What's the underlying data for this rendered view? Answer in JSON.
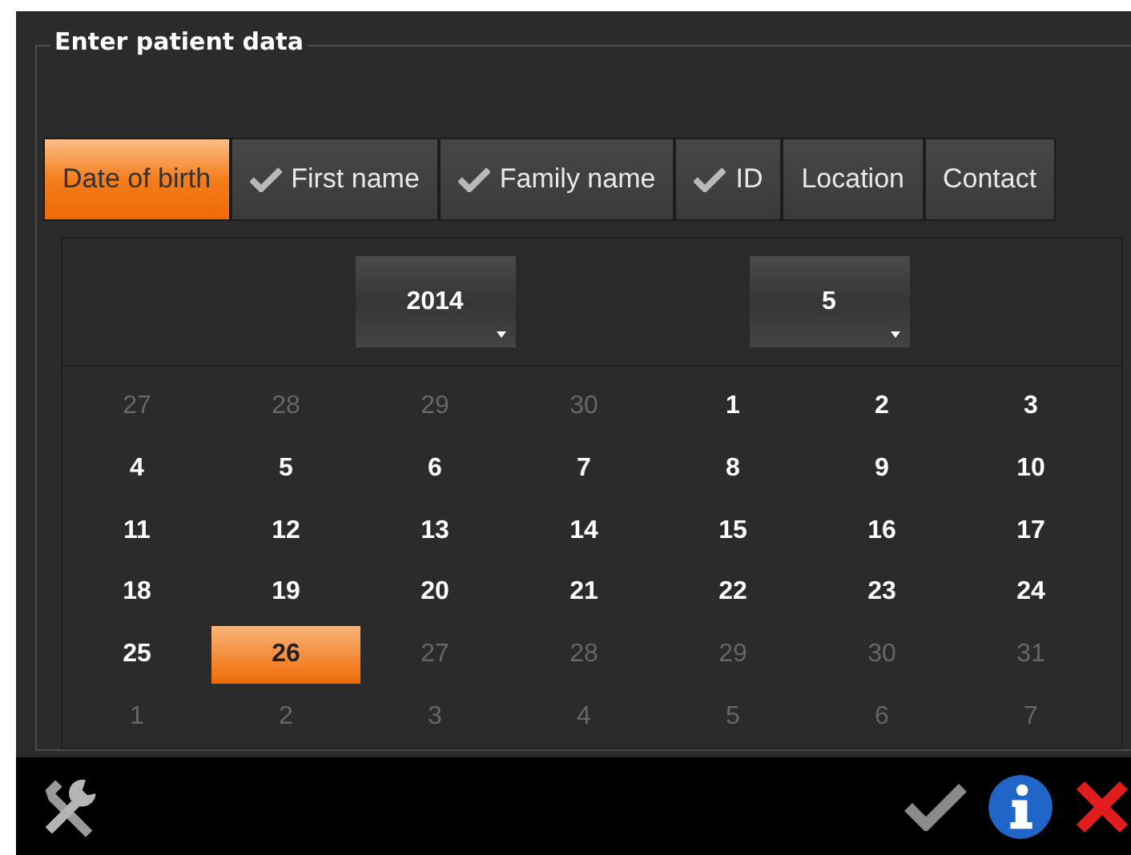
{
  "group_title": "Enter patient data",
  "tabs": [
    {
      "label": "Date of birth",
      "selected": true,
      "checked": false
    },
    {
      "label": "First name",
      "selected": false,
      "checked": true
    },
    {
      "label": "Family name",
      "selected": false,
      "checked": true
    },
    {
      "label": "ID",
      "selected": false,
      "checked": true
    },
    {
      "label": "Location",
      "selected": false,
      "checked": false
    },
    {
      "label": "Contact",
      "selected": false,
      "checked": false
    }
  ],
  "year": {
    "value": "2014"
  },
  "month": {
    "value": "5"
  },
  "days": [
    {
      "label": "27",
      "in_month": false,
      "selected": false
    },
    {
      "label": "28",
      "in_month": false,
      "selected": false
    },
    {
      "label": "29",
      "in_month": false,
      "selected": false
    },
    {
      "label": "30",
      "in_month": false,
      "selected": false
    },
    {
      "label": "1",
      "in_month": true,
      "selected": false
    },
    {
      "label": "2",
      "in_month": true,
      "selected": false
    },
    {
      "label": "3",
      "in_month": true,
      "selected": false
    },
    {
      "label": "4",
      "in_month": true,
      "selected": false
    },
    {
      "label": "5",
      "in_month": true,
      "selected": false
    },
    {
      "label": "6",
      "in_month": true,
      "selected": false
    },
    {
      "label": "7",
      "in_month": true,
      "selected": false
    },
    {
      "label": "8",
      "in_month": true,
      "selected": false
    },
    {
      "label": "9",
      "in_month": true,
      "selected": false
    },
    {
      "label": "10",
      "in_month": true,
      "selected": false
    },
    {
      "label": "11",
      "in_month": true,
      "selected": false
    },
    {
      "label": "12",
      "in_month": true,
      "selected": false
    },
    {
      "label": "13",
      "in_month": true,
      "selected": false
    },
    {
      "label": "14",
      "in_month": true,
      "selected": false
    },
    {
      "label": "15",
      "in_month": true,
      "selected": false
    },
    {
      "label": "16",
      "in_month": true,
      "selected": false
    },
    {
      "label": "17",
      "in_month": true,
      "selected": false
    },
    {
      "label": "18",
      "in_month": true,
      "selected": false
    },
    {
      "label": "19",
      "in_month": true,
      "selected": false
    },
    {
      "label": "20",
      "in_month": true,
      "selected": false
    },
    {
      "label": "21",
      "in_month": true,
      "selected": false
    },
    {
      "label": "22",
      "in_month": true,
      "selected": false
    },
    {
      "label": "23",
      "in_month": true,
      "selected": false
    },
    {
      "label": "24",
      "in_month": true,
      "selected": false
    },
    {
      "label": "25",
      "in_month": true,
      "selected": false
    },
    {
      "label": "26",
      "in_month": true,
      "selected": true
    },
    {
      "label": "27",
      "in_month": false,
      "selected": false
    },
    {
      "label": "28",
      "in_month": false,
      "selected": false
    },
    {
      "label": "29",
      "in_month": false,
      "selected": false
    },
    {
      "label": "30",
      "in_month": false,
      "selected": false
    },
    {
      "label": "31",
      "in_month": false,
      "selected": false
    },
    {
      "label": "1",
      "in_month": false,
      "selected": false
    },
    {
      "label": "2",
      "in_month": false,
      "selected": false
    },
    {
      "label": "3",
      "in_month": false,
      "selected": false
    },
    {
      "label": "4",
      "in_month": false,
      "selected": false
    },
    {
      "label": "5",
      "in_month": false,
      "selected": false
    },
    {
      "label": "6",
      "in_month": false,
      "selected": false
    },
    {
      "label": "7",
      "in_month": false,
      "selected": false
    }
  ]
}
